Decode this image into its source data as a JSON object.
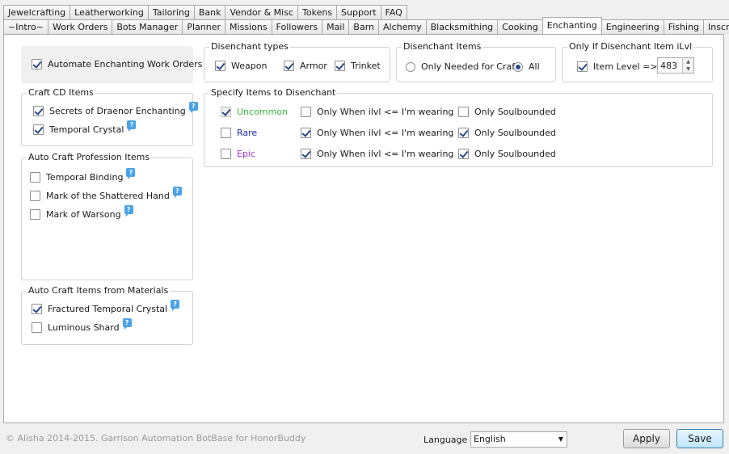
{
  "tabs_row1": [
    "Jewelcrafting",
    "Leatherworking",
    "Tailoring",
    "Bank",
    "Vendor & Misc",
    "Tokens",
    "Support",
    "FAQ"
  ],
  "tabs_row2": [
    "~Intro~",
    "Work Orders",
    "Bots Manager",
    "Planner",
    "Missions",
    "Followers",
    "Mail",
    "Barn",
    "Alchemy",
    "Blacksmithing",
    "Cooking",
    "Enchanting",
    "Engineering",
    "Fishing",
    "Inscription"
  ],
  "active_tab": "Enchanting",
  "automate": {
    "label": "Automate Enchanting Work Orders",
    "checked": true
  },
  "craft_cd": {
    "title": "Craft CD Items",
    "items": [
      {
        "label": "Secrets of Draenor Enchanting",
        "checked": true
      },
      {
        "label": "Temporal Crystal",
        "checked": true
      }
    ]
  },
  "auto_craft_prof": {
    "title": "Auto Craft Profession Items",
    "items": [
      {
        "label": "Temporal Binding",
        "checked": false
      },
      {
        "label": "Mark of the Shattered Hand",
        "checked": false
      },
      {
        "label": "Mark of Warsong",
        "checked": false
      }
    ]
  },
  "auto_craft_mats": {
    "title": "Auto Craft Items from Materials",
    "items": [
      {
        "label": "Fractured Temporal Crystal",
        "checked": true
      },
      {
        "label": "Luminous Shard",
        "checked": false
      }
    ]
  },
  "disenchant_types": {
    "title": "Disenchant types",
    "items": [
      {
        "label": "Weapon",
        "checked": true
      },
      {
        "label": "Armor",
        "checked": true
      },
      {
        "label": "Trinket",
        "checked": true
      }
    ]
  },
  "disenchant_items": {
    "title": "Disenchant Items",
    "options": [
      {
        "label": "Only Needed for Craft",
        "selected": false
      },
      {
        "label": "All",
        "selected": true
      }
    ]
  },
  "ilvl": {
    "title": "Only If Disenchant Item iLvl",
    "label": "Item Level =>",
    "checked": true,
    "value": "483"
  },
  "specify": {
    "title": "Specify Items to Disenchant",
    "ilvl_label": "Only When ilvl <= I'm wearing",
    "soulbound_label": "Only Soulbounded",
    "rows": [
      {
        "quality": "Uncommon",
        "color": "#3ab83a",
        "enabled": true,
        "enabled_dim": true,
        "ilvl": false,
        "soulbound": false
      },
      {
        "quality": "Rare",
        "color": "#1c2fb6",
        "enabled": false,
        "ilvl": true,
        "soulbound": true
      },
      {
        "quality": "Epic",
        "color": "#a335ee",
        "enabled": false,
        "ilvl": true,
        "soulbound": true
      }
    ]
  },
  "footer": {
    "copyright": "© Alisha 2014-2015. Garrison Automation BotBase for HonorBuddy",
    "language_label": "Language",
    "language_value": "English",
    "apply": "Apply",
    "save": "Save"
  },
  "icons": {
    "help": "help-badge-icon",
    "dropdown": "dropdown-arrow-icon"
  }
}
